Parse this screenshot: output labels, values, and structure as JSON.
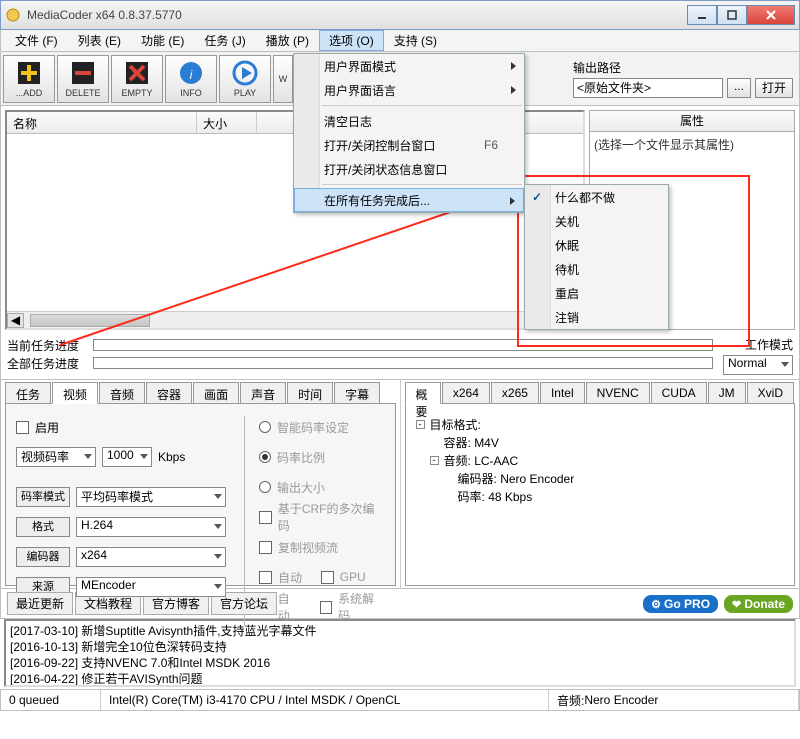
{
  "title": "MediaCoder x64 0.8.37.5770",
  "menubar": [
    "文件 (F)",
    "列表 (E)",
    "功能 (E)",
    "任务 (J)",
    "播放 (P)",
    "选项 (O)",
    "支持 (S)"
  ],
  "menubar_open_index": 5,
  "toolbar": {
    "add": "...ADD",
    "delete": "DELETE",
    "empty": "EMPTY",
    "info": "INFO",
    "play": "PLAY",
    "w": "W"
  },
  "output": {
    "label": "输出路径",
    "value": "<原始文件夹>",
    "browse": "...",
    "open": "打开"
  },
  "list": {
    "col_name": "名称",
    "col_size": "大小"
  },
  "properties": {
    "header": "属性",
    "hint": "(选择一个文件显示其属性)"
  },
  "progress": {
    "current": "当前任务进度",
    "all": "全部任务进度",
    "workmode_label": "工作模式",
    "workmode_value": "Normal"
  },
  "left_tabs": [
    "任务",
    "视频",
    "音频",
    "容器",
    "画面",
    "声音",
    "时间",
    "字幕"
  ],
  "left_active": 1,
  "right_tabs": [
    "概要",
    "x264",
    "x265",
    "Intel",
    "NVENC",
    "CUDA",
    "JM",
    "XviD"
  ],
  "right_active": 0,
  "video_tab": {
    "enable": "启用",
    "rate_mode": "视频码率",
    "rate_value": "1000",
    "rate_unit": "Kbps",
    "labels": {
      "rm": "码率模式",
      "fmt": "格式",
      "enc": "编码器",
      "src": "来源"
    },
    "vals": {
      "rm": "平均码率模式",
      "fmt": "H.264",
      "enc": "x264",
      "src": "MEncoder"
    },
    "right_opts": {
      "smart": "智能码率设定",
      "ratio": "码率比例",
      "size": "输出大小",
      "crf": "基于CRF的多次编码",
      "copy": "复制视频流",
      "auto1": "自动",
      "gpu": "GPU",
      "auto2": "自动",
      "sysdec": "系统解码"
    }
  },
  "summary": {
    "root": "目标格式:",
    "container_label": "容器:",
    "container": "M4V",
    "audio_label": "音频:",
    "audio": "LC-AAC",
    "encoder_label": "编码器:",
    "encoder": "Nero Encoder",
    "bitrate_label": "码率:",
    "bitrate": "48 Kbps"
  },
  "dropdown1": {
    "ui_mode": "用户界面模式",
    "ui_lang": "用户界面语言",
    "clear_log": "清空日志",
    "toggle_console": "打开/关闭控制台窗口",
    "toggle_console_key": "F6",
    "toggle_status": "打开/关闭状态信息窗口",
    "after_tasks": "在所有任务完成后..."
  },
  "dropdown2": [
    "什么都不做",
    "关机",
    "休眠",
    "待机",
    "重启",
    "注销"
  ],
  "dropdown2_checked": 0,
  "bottom_links": [
    "最近更新",
    "文档教程",
    "官方博客",
    "官方论坛"
  ],
  "gopro": "Go PRO",
  "donate": "Donate",
  "news": [
    "[2017-03-10] 新增Suptitle Avisynth插件,支持蓝光字幕文件",
    "[2016-10-13] 新增完全10位色深转码支持",
    "[2016-09-22] 支持NVENC 7.0和Intel MSDK 2016",
    "[2016-04-22] 修正若干AVISynth问题"
  ],
  "status": {
    "queue": "0 queued",
    "cpu": "Intel(R) Core(TM) i3-4170 CPU  / Intel MSDK / OpenCL",
    "audio_label": "音频:",
    "audio": "Nero Encoder"
  }
}
